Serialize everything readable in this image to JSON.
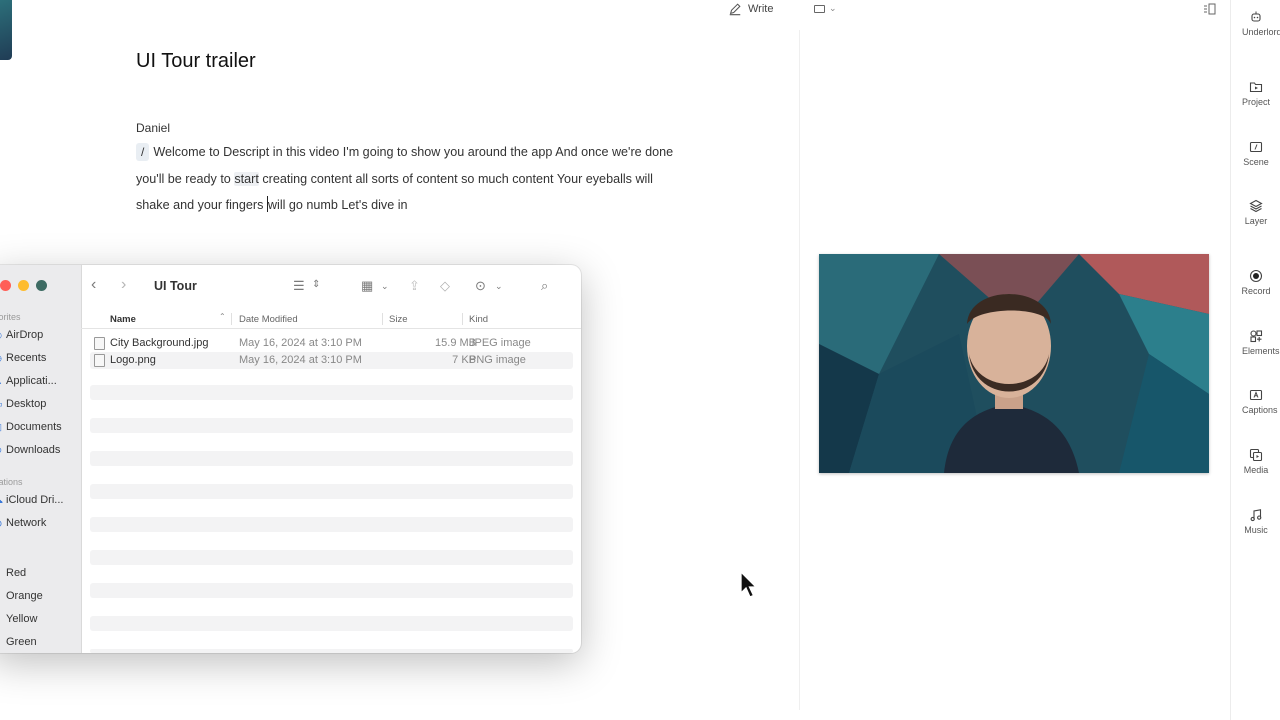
{
  "topbar": {
    "write_label": "Write"
  },
  "document": {
    "title": "UI Tour trailer",
    "speaker": "Daniel",
    "slash": "/",
    "line1": "Welcome to Descript in this video I'm going to show you around the app And once we're done",
    "line2a": "you'll be ready to ",
    "line2_hl": "start",
    "line2b": " creating content all sorts of content so much content Your eyeballs will",
    "line3a": "shake and your fingers ",
    "line3b": "will go numb Let's dive in"
  },
  "right_rail": {
    "items": [
      {
        "label": "Underlord",
        "icon": "robot-icon"
      },
      {
        "label": "Project",
        "icon": "folder-play-icon"
      },
      {
        "label": "Scene",
        "icon": "scene-icon"
      },
      {
        "label": "Layer",
        "icon": "layers-icon"
      },
      {
        "label": "Record",
        "icon": "record-icon"
      },
      {
        "label": "Elements",
        "icon": "elements-icon"
      },
      {
        "label": "Captions",
        "icon": "captions-icon"
      },
      {
        "label": "Media",
        "icon": "media-icon"
      },
      {
        "label": "Music",
        "icon": "music-icon"
      }
    ]
  },
  "finder": {
    "title": "UI Tour",
    "sidebar": {
      "favorites_label": "vorites",
      "favorites": [
        "AirDrop",
        "Recents",
        "Applicati...",
        "Desktop",
        "Documents",
        "Downloads"
      ],
      "locations_label": "cations",
      "locations": [
        "iCloud Dri...",
        "Network"
      ],
      "tags_label": "s",
      "tags": [
        "Red",
        "Orange",
        "Yellow",
        "Green"
      ]
    },
    "columns": {
      "name": "Name",
      "date": "Date Modified",
      "size": "Size",
      "kind": "Kind"
    },
    "files": [
      {
        "name": "City Background.jpg",
        "date": "May 16, 2024 at 3:10 PM",
        "size": "15.9 MB",
        "kind": "JPEG image"
      },
      {
        "name": "Logo.png",
        "date": "May 16, 2024 at 3:10 PM",
        "size": "7 KB",
        "kind": "PNG image"
      }
    ]
  },
  "colors": {
    "light_red": "#ff5f57",
    "light_yellow": "#febc2e",
    "light_dark": "#3d6b63"
  }
}
